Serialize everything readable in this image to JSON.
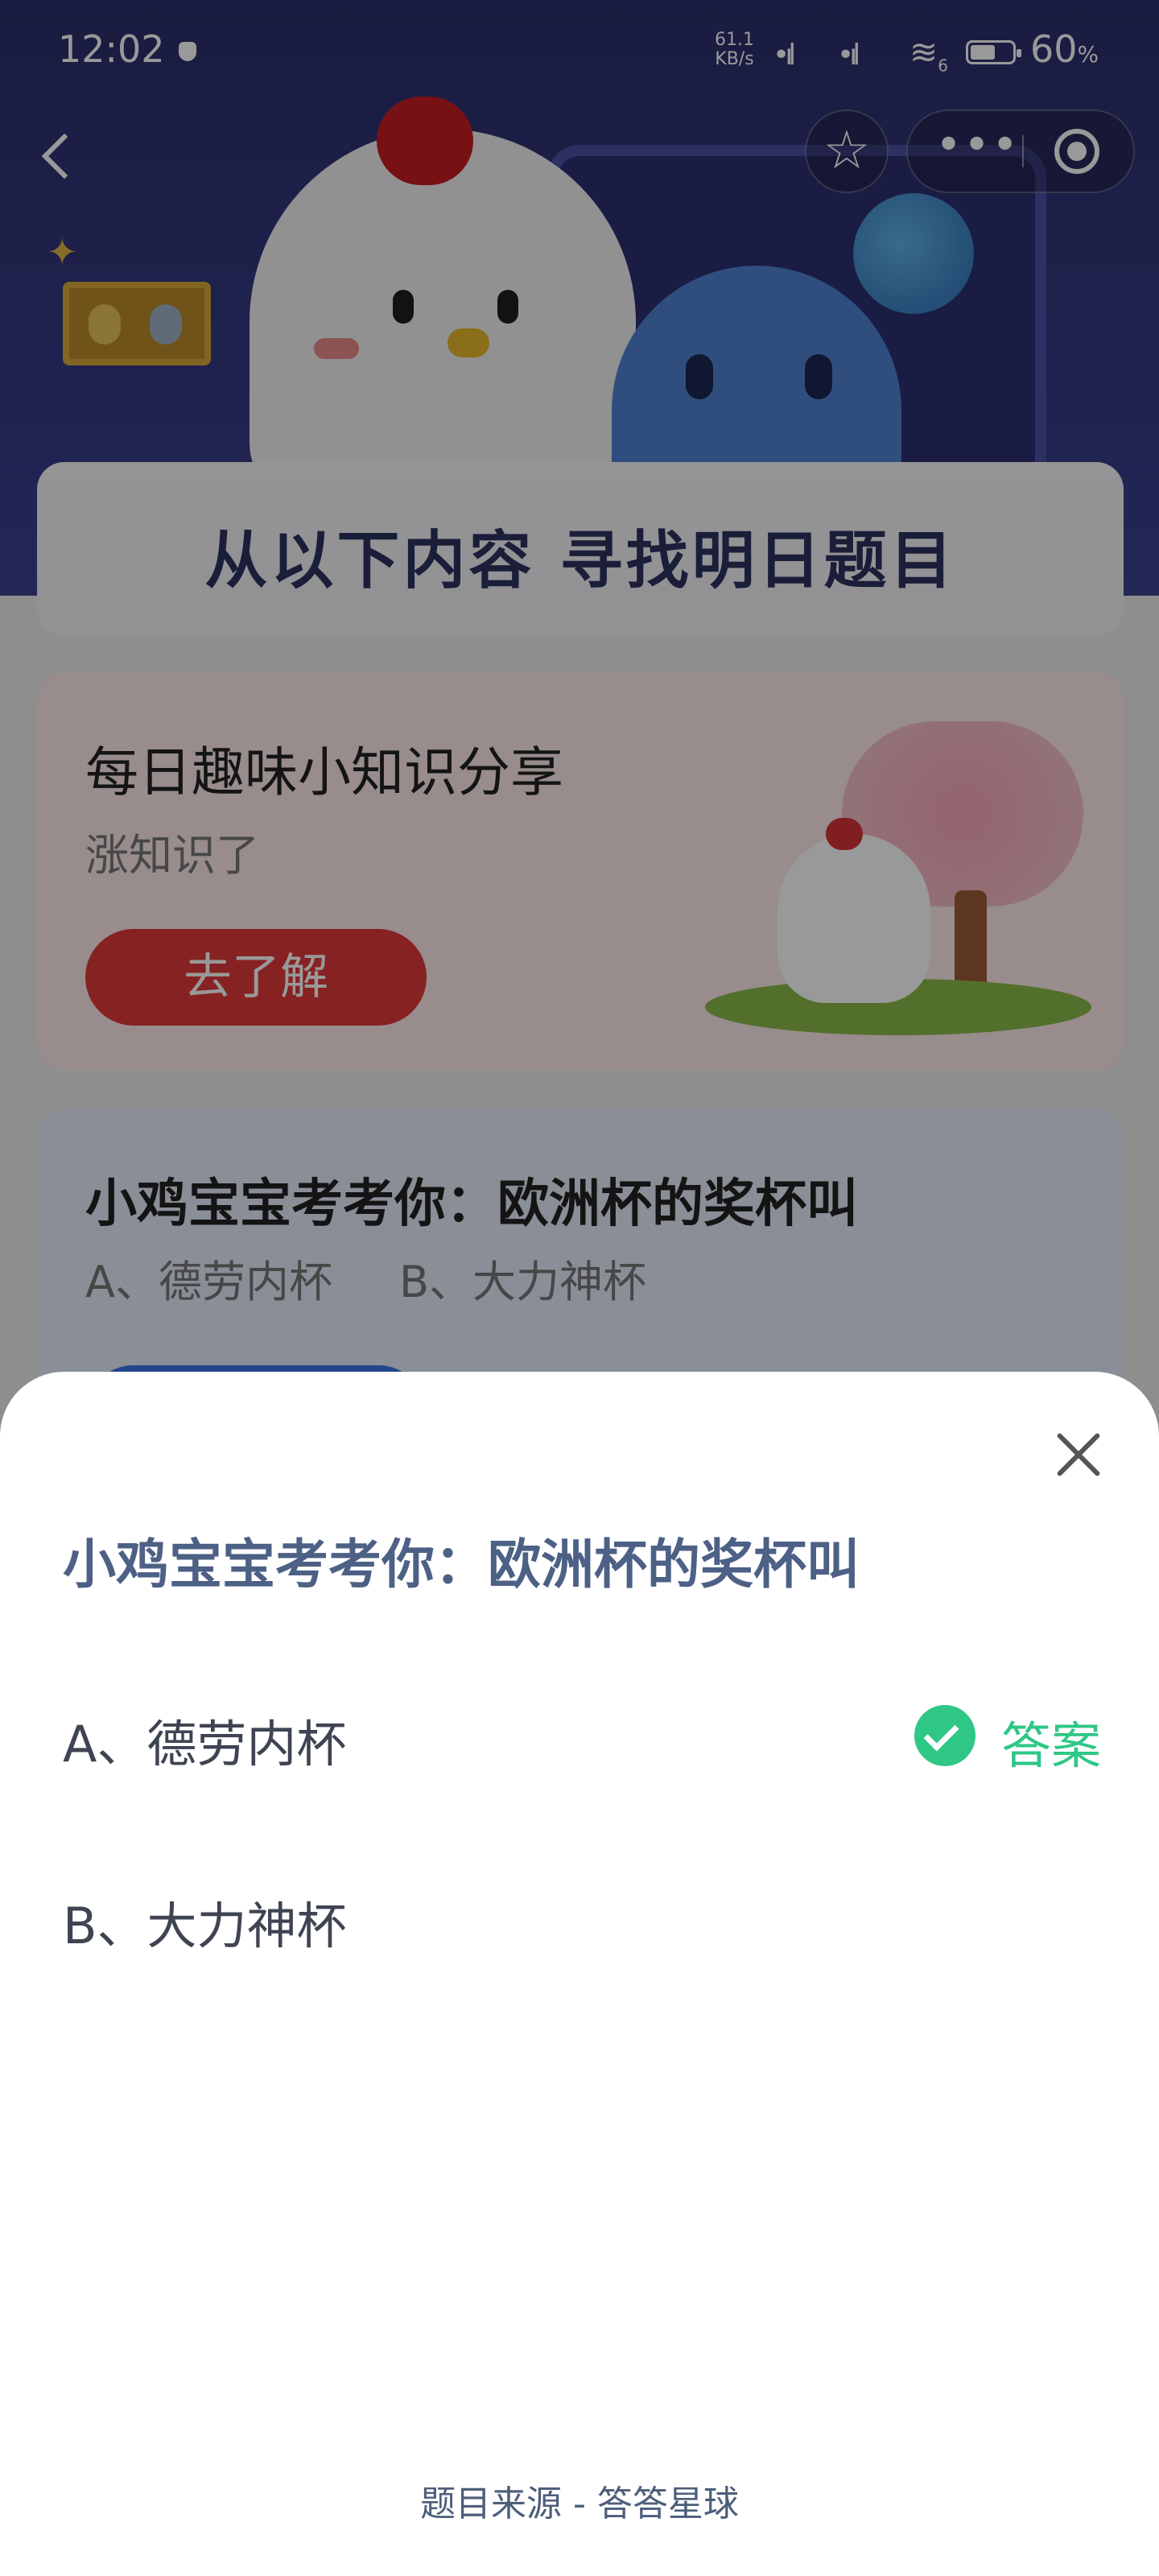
{
  "status_bar": {
    "time": "12:02",
    "net_speed_value": "61.1",
    "net_speed_unit": "KB/s",
    "wifi_sub": "6",
    "battery_percent": 0.6,
    "battery_text": "60",
    "battery_unit": "%"
  },
  "nav": {
    "back_icon": "chevron-left-icon",
    "favorite_icon": "star-icon",
    "more_icon": "more-icon",
    "close_icon": "target-icon"
  },
  "page": {
    "banner_title": "从以下内容 寻找明日题目",
    "knowledge_card": {
      "title": "每日趣味小知识分享",
      "subtitle": "涨知识了",
      "button_label": "去了解"
    },
    "quiz_card": {
      "title": "小鸡宝宝考考你：欧洲杯的奖杯叫",
      "option_a": "A、德劳内杯",
      "option_b": "B、大力神杯"
    }
  },
  "sheet": {
    "question": "小鸡宝宝考考你：欧洲杯的奖杯叫",
    "options": [
      {
        "label": "A、德劳内杯",
        "is_answer": true
      },
      {
        "label": "B、大力神杯",
        "is_answer": false
      }
    ],
    "answer_label": "答案",
    "source": "题目来源 - 答答星球"
  },
  "colors": {
    "answer_green": "#2fc785",
    "question_blue": "#4d6085",
    "hero_navy": "#2b2f6b"
  }
}
